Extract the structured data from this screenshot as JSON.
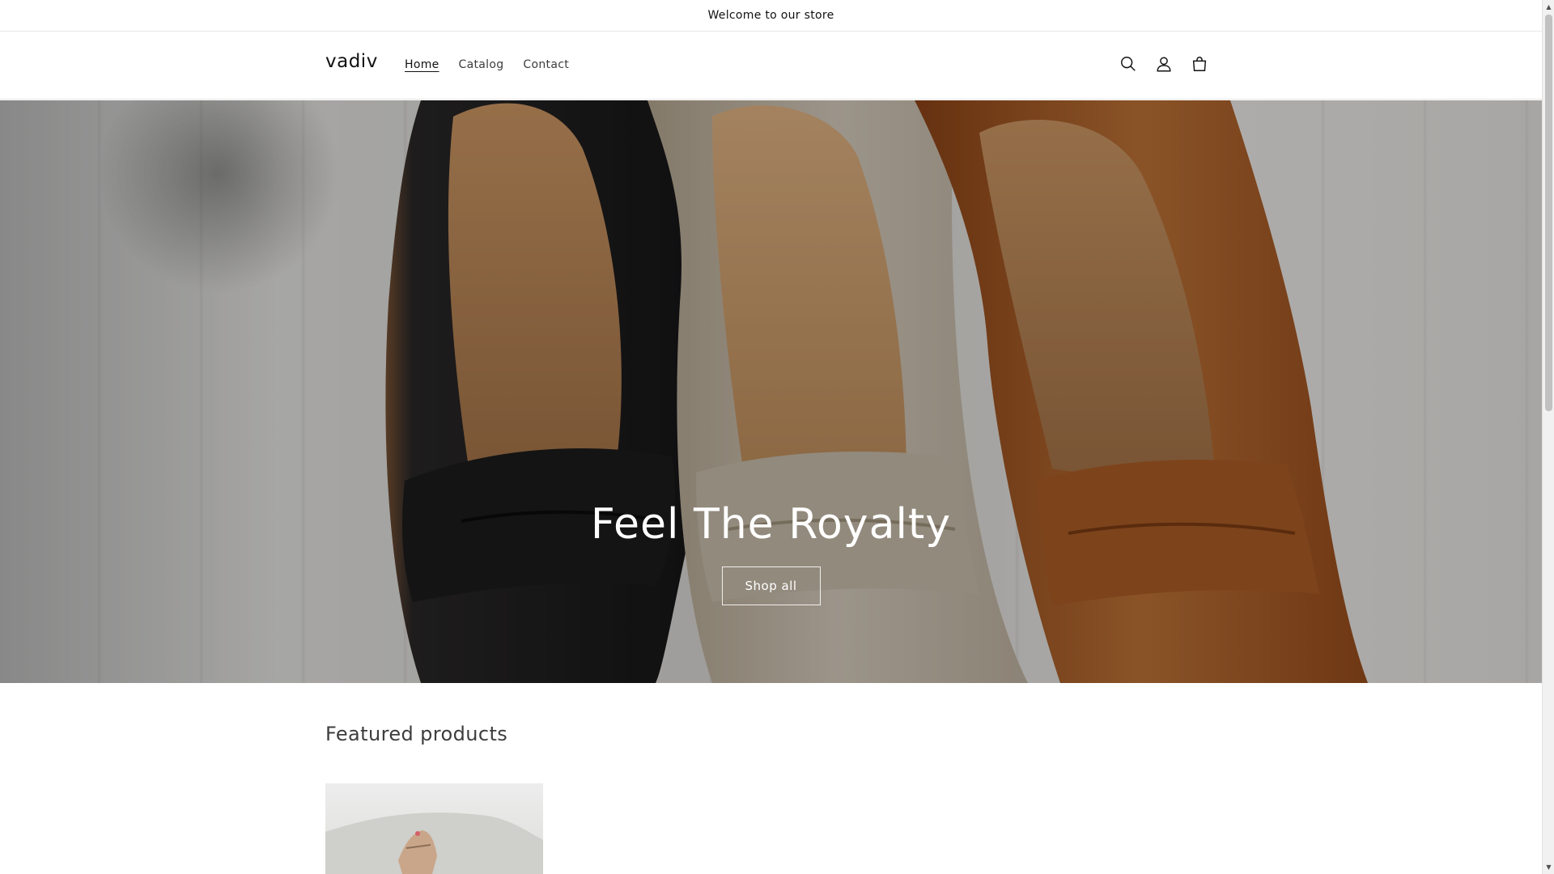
{
  "announcement": {
    "text": "Welcome to our store"
  },
  "header": {
    "logo": "vadiv",
    "nav": [
      {
        "label": "Home",
        "active": true
      },
      {
        "label": "Catalog",
        "active": false
      },
      {
        "label": "Contact",
        "active": false
      }
    ],
    "icons": [
      "search-icon",
      "account-icon",
      "cart-icon"
    ]
  },
  "hero": {
    "title": "Feel The Royalty",
    "button_label": "Shop all"
  },
  "featured": {
    "title": "Featured products"
  },
  "colors": {
    "text": "#121212",
    "muted": "#3d3d3d",
    "border": "#e6e6e6",
    "shoe_black": "#1e1e1f",
    "shoe_beige": "#c9bca8",
    "shoe_tan": "#b8692f"
  }
}
